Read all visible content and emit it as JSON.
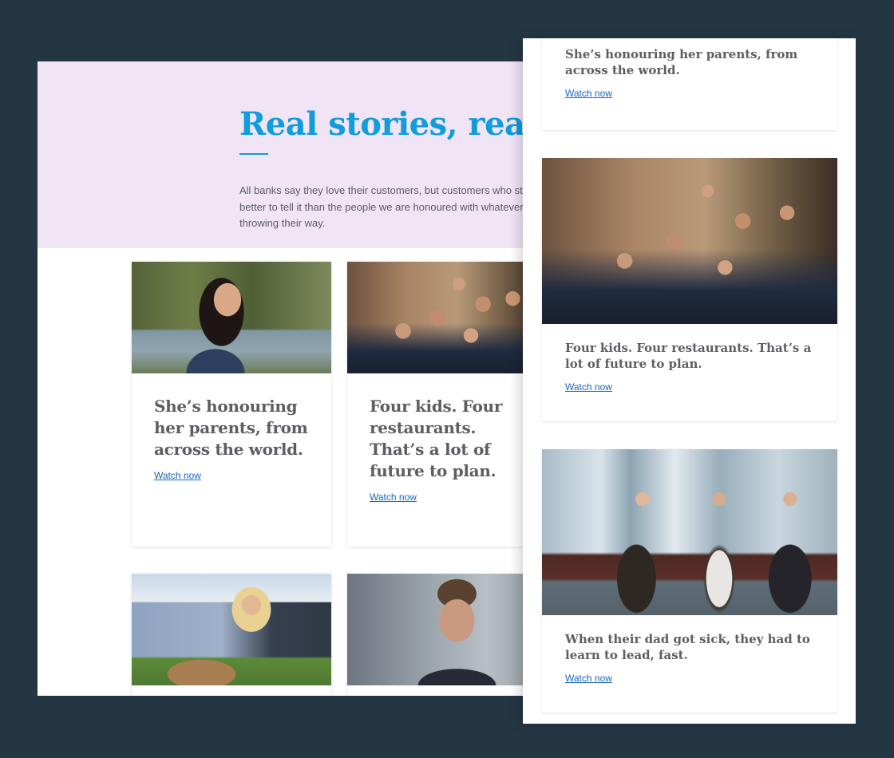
{
  "desktop": {
    "hero": {
      "title": "Real stories, real",
      "body": "All banks say they love their customers, but customers who story. Who better to tell it than the people we are honoured with whatever life is throwing their way."
    },
    "cards": [
      {
        "title": "She’s honouring her parents, from across the world.",
        "link": "Watch now",
        "image": "woman-smiling-by-river-photo"
      },
      {
        "title": "Four kids. Four restaurants. That’s a lot of future to plan.",
        "link": "Watch now",
        "image": "family-in-restaurant-photo"
      },
      {
        "title": "",
        "link": "",
        "image": "woman-with-dog-photo"
      },
      {
        "title": "",
        "link": "",
        "image": "man-smiling-photo"
      }
    ]
  },
  "mobile": {
    "cards": [
      {
        "title": "She’s honouring her parents, from across the world.",
        "link": "Watch now"
      },
      {
        "title": "Four kids. Four restaurants. That’s a lot of future to plan.",
        "link": "Watch now",
        "image": "family-in-restaurant-photo"
      },
      {
        "title": "When their dad got sick, they had to learn to lead, fast.",
        "link": "Watch now",
        "image": "three-sisters-photo"
      }
    ]
  },
  "colors": {
    "background": "#243644",
    "hero_bg": "#f0e4f5",
    "accent": "#0f9ddb",
    "title_text": "#5d5e63",
    "link": "#1565c0"
  }
}
